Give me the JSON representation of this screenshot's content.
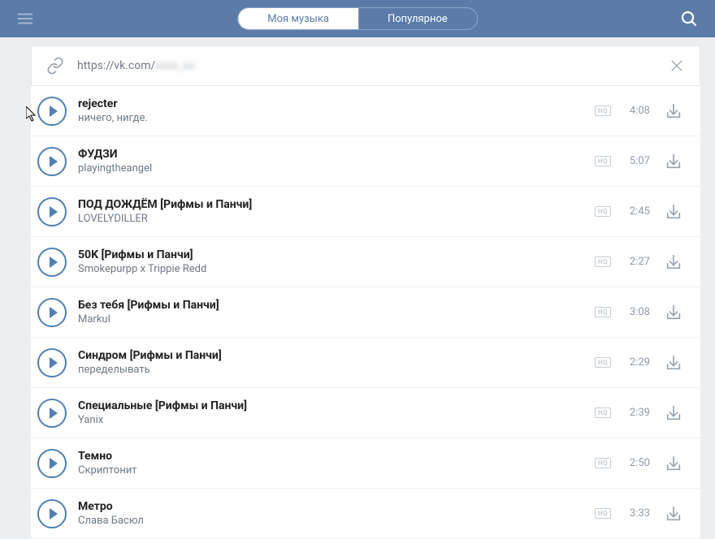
{
  "header": {
    "tabs": {
      "my_music": "Моя музыка",
      "popular": "Популярное"
    }
  },
  "url_bar": {
    "prefix": "https://vk.com/",
    "obscured": "xxxx_xx"
  },
  "hq_label": "HQ",
  "tracks": [
    {
      "title": "rejecter",
      "artist": "ничего, нигде.",
      "duration": "4:08"
    },
    {
      "title": "ФУДЗИ",
      "artist": "playingtheangel",
      "duration": "5:07"
    },
    {
      "title": "ПОД ДОЖДЁМ [Рифмы и Панчи]",
      "artist": "LOVELYDILLER",
      "duration": "2:45"
    },
    {
      "title": "50K [Рифмы и Панчи]",
      "artist": "Smokepurpp x Trippie Redd",
      "duration": "2:27"
    },
    {
      "title": "Без тебя [Рифмы и Панчи]",
      "artist": "Markul",
      "duration": "3:08"
    },
    {
      "title": "Синдром [Рифмы и Панчи]",
      "artist": "переделывать",
      "duration": "2:29"
    },
    {
      "title": "Специальные [Рифмы и Панчи]",
      "artist": "Yanix",
      "duration": "2:39"
    },
    {
      "title": "Темно",
      "artist": "Скриптонит",
      "duration": "2:50"
    },
    {
      "title": "Метро",
      "artist": "Слава Басюл",
      "duration": "3:33"
    }
  ]
}
